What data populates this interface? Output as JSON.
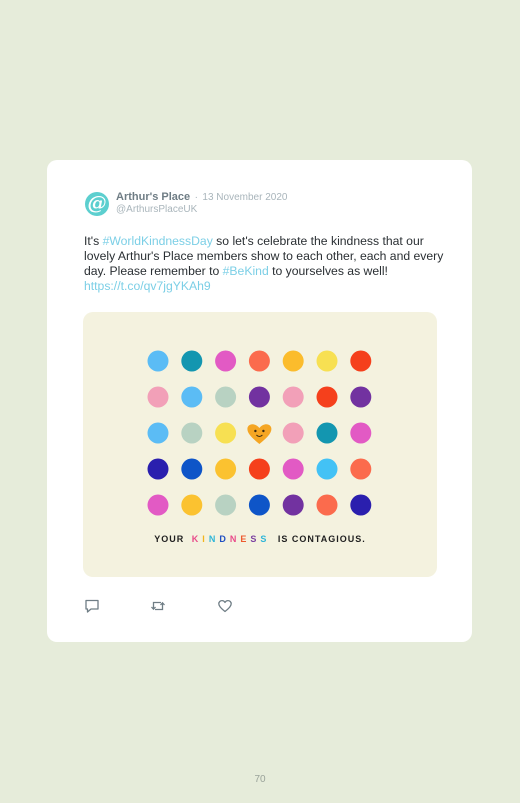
{
  "tweet": {
    "author_name": "Arthur's Place",
    "separator": "·",
    "date": "13 November 2020",
    "handle": "@ArthursPlaceUK",
    "avatar_letter": "@",
    "avatar_color": "#5ccfcf",
    "text": {
      "part1": "It's ",
      "hashtag1": "#WorldKindnessDay",
      "part2": " so let's celebrate the kindness that our lovely Arthur's Place members show to each other, each and every day. Please remember to ",
      "hashtag2": "#BeKind",
      "part3": " to yourselves as well! ",
      "url": "https://t.co/qv7jgYKAh9"
    },
    "link_color": "#7ccfe6"
  },
  "image": {
    "tagline_before": "YOUR",
    "tagline_word_letters": [
      {
        "ch": "K",
        "color": "#e94b8a"
      },
      {
        "ch": "I",
        "color": "#f2b51c"
      },
      {
        "ch": "N",
        "color": "#2fb6d8"
      },
      {
        "ch": "D",
        "color": "#1f4fc2"
      },
      {
        "ch": "N",
        "color": "#e94b8a"
      },
      {
        "ch": "E",
        "color": "#ee5a2e"
      },
      {
        "ch": "S",
        "color": "#7b3fa0"
      },
      {
        "ch": "S",
        "color": "#2fb6d8"
      }
    ],
    "tagline_after": "IS CONTAGIOUS.",
    "heart_color": "#f5a623",
    "dot_grid": [
      [
        "#5bbcf5",
        "#1396b0",
        "#e25ac4",
        "#fb6b4d",
        "#fbbc2c",
        "#f7e052",
        "#f5401c"
      ],
      [
        "#f2a0b8",
        "#5bbcf5",
        "#b8d2c2",
        "#7232a0",
        "#f2a0b8",
        "#f5401c",
        "#7232a0"
      ],
      [
        "#5bbcf5",
        "#b8d2c2",
        "#f7e052",
        "heart",
        "#f2a0b8",
        "#1396b0",
        "#e25ac4"
      ],
      [
        "#2a1fae",
        "#0e55c8",
        "#fbc230",
        "#f5401c",
        "#e25ac4",
        "#43c2f5",
        "#fb6b4d"
      ],
      [
        "#e25ac4",
        "#fbc230",
        "#b8d2c2",
        "#0e55c8",
        "#7232a0",
        "#fb6b4d",
        "#2a1fae"
      ]
    ]
  },
  "actions": [
    {
      "icon": "reply-icon"
    },
    {
      "icon": "retweet-icon"
    },
    {
      "icon": "like-icon"
    }
  ],
  "page_number": "70"
}
